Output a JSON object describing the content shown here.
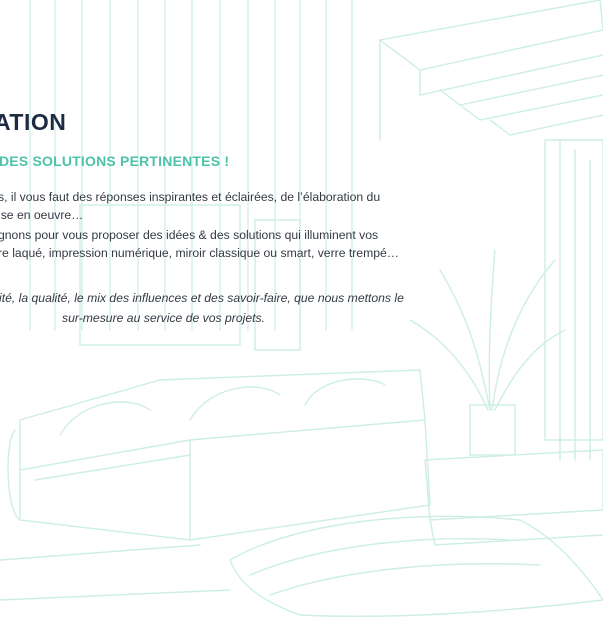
{
  "heading": {
    "title": "ATION",
    "subtitle": "DES SOLUTIONS PERTINENTES !"
  },
  "paragraphs": [
    "s, il vous faut des réponses inspirantes et éclairées, de l’élaboration du",
    "ise en oeuvre…",
    "gnons pour vous proposer des idées & des solutions qui illuminent vos",
    "re laqué, impression numérique, miroir classique ou smart, verre trempé…"
  ],
  "quote": {
    "line1": "ité, la qualité, le mix des influences et des savoir-faire, que nous mettons le",
    "line2": "sur-mesure au service de vos projets."
  },
  "colors": {
    "heading": "#1f2b45",
    "accent": "#4cc3a8",
    "text": "#333a44",
    "sketch": "#cdeee5"
  },
  "background": "interior-sketch-illustration"
}
